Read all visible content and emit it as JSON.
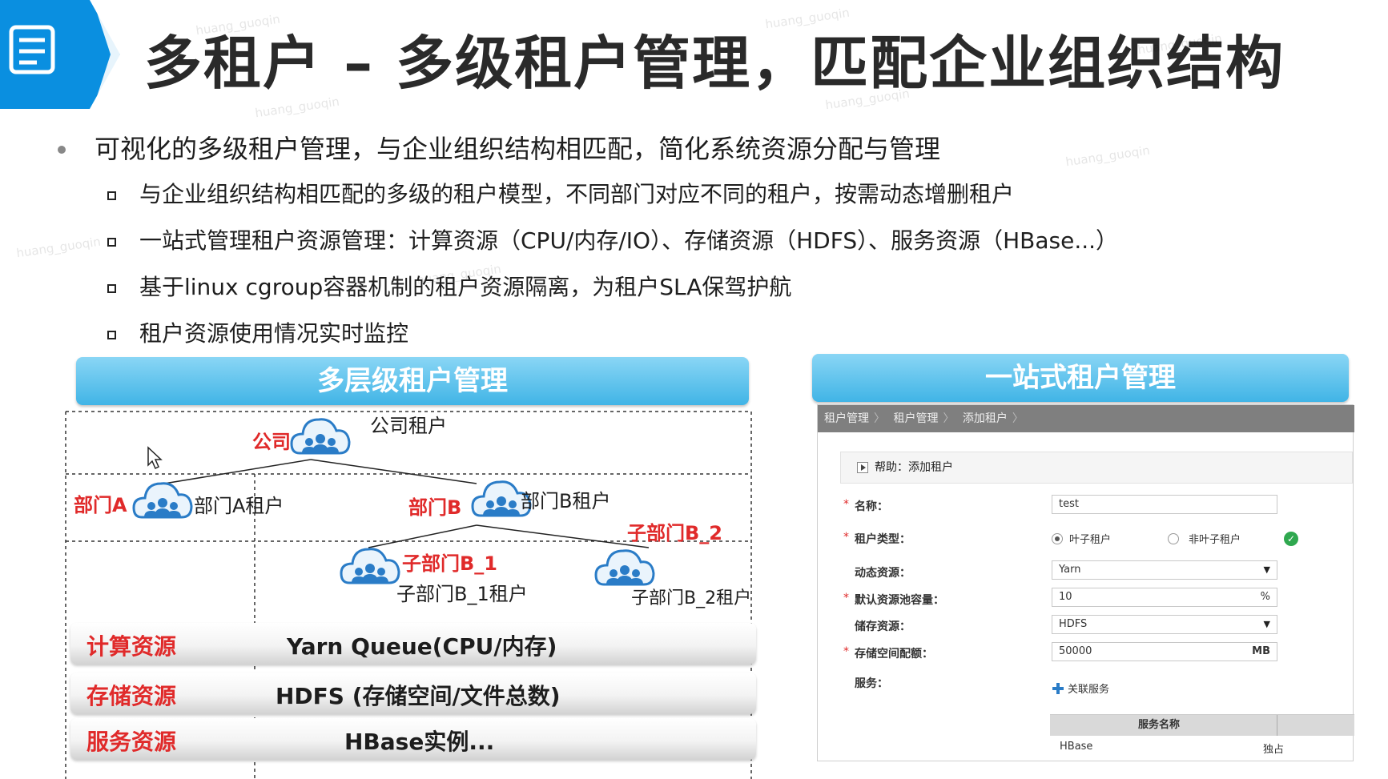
{
  "title": "多租户 – 多级租户管理，匹配企业组织结构",
  "bullets": {
    "main": "可视化的多级租户管理，与企业组织结构相匹配，简化系统资源分配与管理",
    "subs": [
      "与企业组织结构相匹配的多级的租户模型，不同部门对应不同的租户，按需动态增删租户",
      "一站式管理租户资源管理：计算资源（CPU/内存/IO）、存储资源（HDFS）、服务资源（HBase...）",
      "基于linux cgroup容器机制的租户资源隔离，为租户SLA保驾护航",
      "租户资源使用情况实时监控"
    ]
  },
  "left_panel": {
    "header": "多层级租户管理",
    "org": {
      "company_label": "公司",
      "company_tenant": "公司租户",
      "dept_a_label": "部门A",
      "dept_a_tenant": "部门A租户",
      "dept_b_label": "部门B",
      "dept_b_tenant": "部门B租户",
      "sub_b1_label": "子部门B_1",
      "sub_b1_tenant": "子部门B_1租户",
      "sub_b2_label": "子部门B_2",
      "sub_b2_tenant": "子部门B_2租户"
    },
    "resources": [
      {
        "label": "计算资源",
        "value": "Yarn Queue(CPU/内存)"
      },
      {
        "label": "存储资源",
        "value": "HDFS (存储空间/文件总数)"
      },
      {
        "label": "服务资源",
        "value": "HBase实例..."
      }
    ]
  },
  "right_panel": {
    "header": "一站式租户管理",
    "breadcrumb": [
      "租户管理",
      "租户管理",
      "添加租户"
    ],
    "help": "帮助：添加租户",
    "fields": {
      "name_label": "名称：",
      "name_value": "test",
      "type_label": "租户类型：",
      "type_leaf": "叶子租户",
      "type_nonleaf": "非叶子租户",
      "dynamic_label": "动态资源：",
      "dynamic_value": "Yarn",
      "capacity_label": "默认资源池容量：",
      "capacity_value": "10",
      "capacity_unit": "%",
      "storage_label": "储存资源：",
      "storage_value": "HDFS",
      "quota_label": "存储空间配额：",
      "quota_value": "50000",
      "quota_unit": "MB",
      "service_label": "服务：",
      "link_service": "关联服务"
    },
    "service_table": {
      "header": "服务名称",
      "row": {
        "name": "HBase",
        "mode": "独占"
      }
    }
  },
  "watermark": "huang_guoqin",
  "colors": {
    "accent_blue": "#1a9be0",
    "panel_blue": "#40b4e6",
    "label_red": "#e02a2a",
    "cloud_blue": "#2a7cc7"
  }
}
